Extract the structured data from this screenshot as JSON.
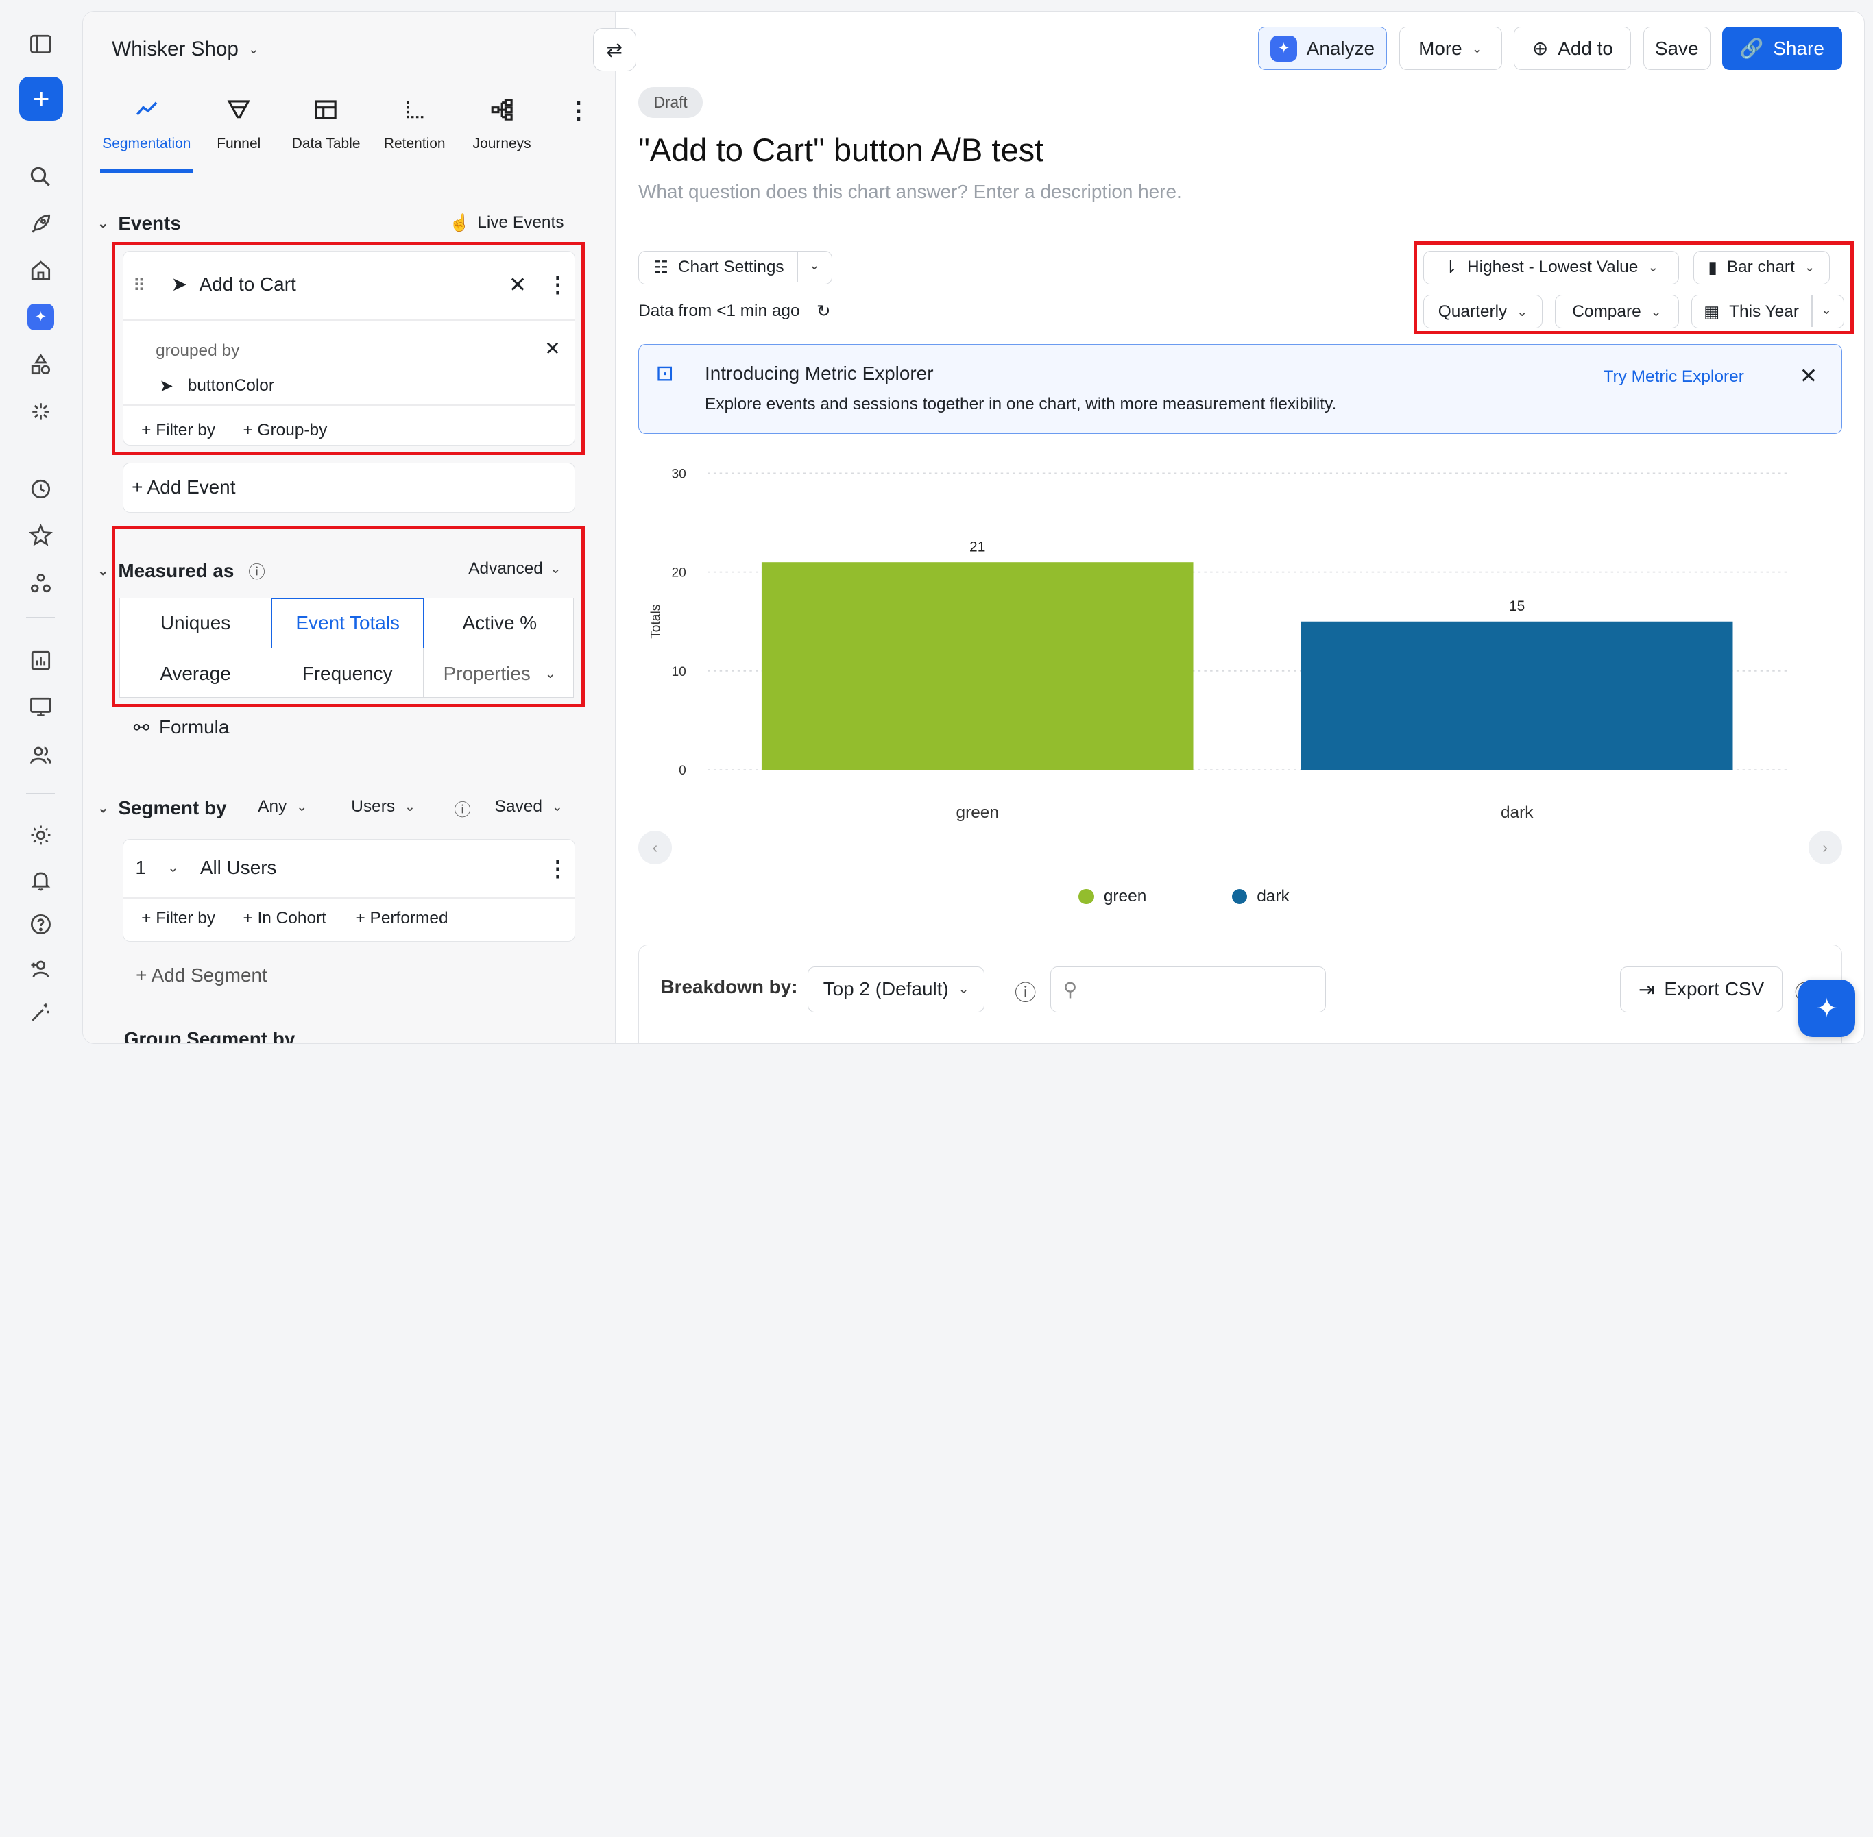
{
  "sidebar": {
    "shop_name": "Whisker Shop",
    "tabs": [
      {
        "label": "Segmentation",
        "icon": "segmentation-icon"
      },
      {
        "label": "Funnel",
        "icon": "funnel-icon"
      },
      {
        "label": "Data Table",
        "icon": "data-table-icon"
      },
      {
        "label": "Retention",
        "icon": "retention-icon"
      },
      {
        "label": "Journeys",
        "icon": "journeys-icon"
      }
    ],
    "events_heading": "Events",
    "live_events": "Live Events",
    "event_name": "Add to Cart",
    "grouped_by_label": "grouped by",
    "group_property": "buttonColor",
    "filter_by": "+ Filter by",
    "group_by": "+ Group-by",
    "add_event": "+ Add Event",
    "measured_as": "Measured as",
    "advanced": "Advanced",
    "measures": [
      "Uniques",
      "Event Totals",
      "Active %",
      "Average",
      "Frequency",
      "Properties"
    ],
    "formula": "Formula",
    "segment_by": "Segment by",
    "any": "Any",
    "users": "Users",
    "saved": "Saved",
    "segment_index": "1",
    "segment_name": "All Users",
    "seg_filter_by": "+ Filter by",
    "in_cohort": "+ In Cohort",
    "performed": "+ Performed",
    "add_segment": "+ Add Segment",
    "group_segment_by": "Group Segment by"
  },
  "toolbar": {
    "analyze": "Analyze",
    "more": "More",
    "add_to": "Add to",
    "save": "Save",
    "share": "Share"
  },
  "chart_header": {
    "status": "Draft",
    "title": "\"Add to Cart\" button A/B test",
    "description": "What question does this chart answer? Enter a description here.",
    "chart_settings": "Chart Settings",
    "data_from": "Data from <1 min ago",
    "sort": "Highest - Lowest Value",
    "chart_type": "Bar chart",
    "interval": "Quarterly",
    "compare": "Compare",
    "range": "This Year"
  },
  "banner": {
    "title": "Introducing Metric Explorer",
    "body": "Explore events and sessions together in one chart, with more measurement flexibility.",
    "link": "Try Metric Explorer"
  },
  "chart_data": {
    "type": "bar",
    "categories": [
      "green",
      "dark"
    ],
    "values": [
      21,
      15
    ],
    "colors": [
      "#93bd2d",
      "#12679b"
    ],
    "ylabel": "Totals",
    "ylim": [
      0,
      30
    ],
    "yticks": [
      0,
      10,
      20,
      30
    ],
    "legend": [
      "green",
      "dark"
    ]
  },
  "breakdown": {
    "label": "Breakdown by:",
    "selected": "Top 2 (Default)",
    "export": "Export CSV"
  }
}
